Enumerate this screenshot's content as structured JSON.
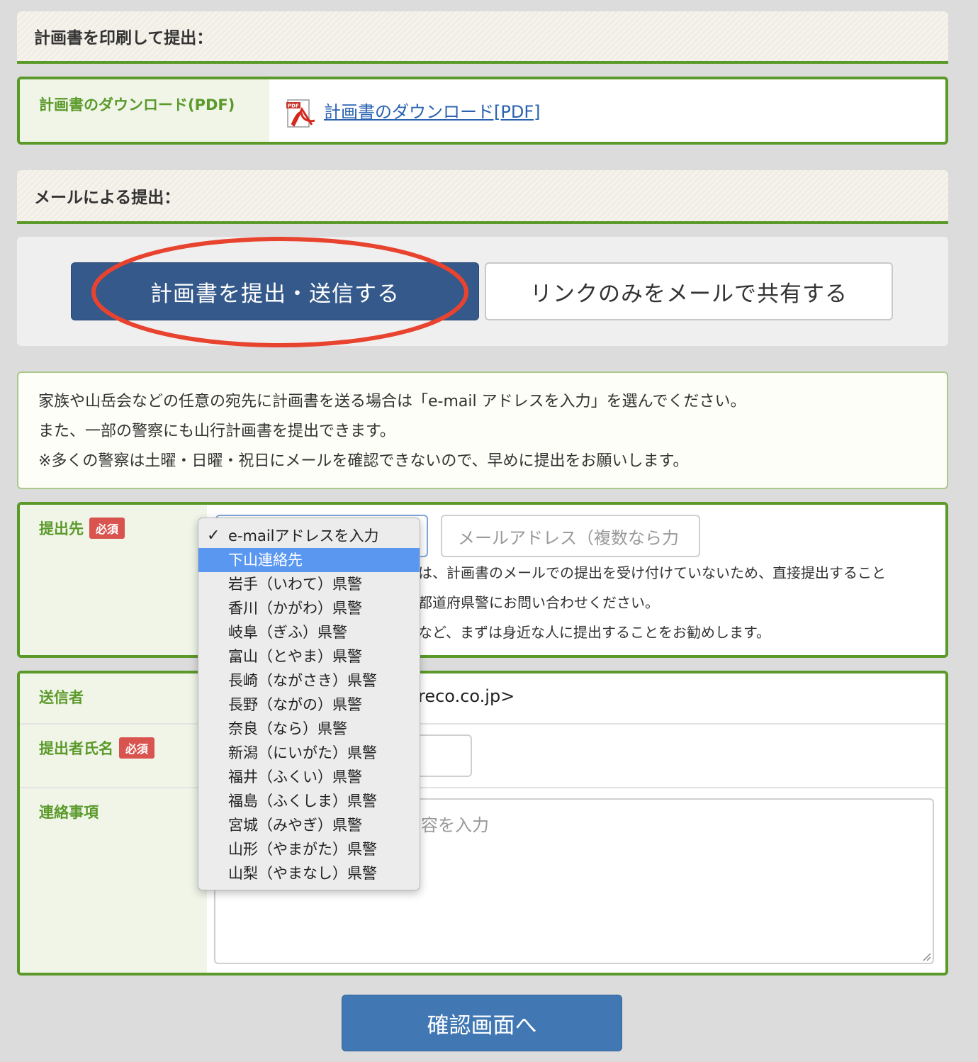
{
  "print_section": {
    "title": "計画書を印刷して提出：",
    "download_label": "計画書のダウンロード(PDF)",
    "download_link": "計画書のダウンロード[PDF]",
    "pdf_icon_text": "PDF"
  },
  "mail_section": {
    "title": "メールによる提出："
  },
  "buttons": {
    "submit": "計画書を提出・送信する",
    "share": "リンクのみをメールで共有する",
    "confirm": "確認画面へ"
  },
  "notice": {
    "line1": "家族や山岳会などの任意の宛先に計画書を送る場合は「e-mail アドレスを入力」を選んでください。",
    "line2": "また、一部の警察にも山行計画書を提出できます。",
    "line3": "※多くの警察は土曜・日曜・祝日にメールを確認できないので、早めに提出をお願いします。"
  },
  "destination": {
    "label": "提出先",
    "required": "必須",
    "email_placeholder": "メールアドレス（複数なら力",
    "help1": "は、計画書のメールでの提出を受け付けていないため、直接提出すること",
    "help2": "都道府県警にお問い合わせください。",
    "help3": "など、まずは身近な人に提出することをお勧めします。"
  },
  "dropdown": {
    "selected": "e-mailアドレスを入力",
    "highlighted": "下山連絡先",
    "options": [
      "岩手（いわて）県警",
      "香川（かがわ）県警",
      "岐阜（ぎふ）県警",
      "富山（とやま）県警",
      "長崎（ながさき）県警",
      "長野（ながの）県警",
      "奈良（なら）県警",
      "新潟（にいがた）県警",
      "福井（ふくい）県警",
      "福島（ふくしま）県警",
      "宮城（みやぎ）県警",
      "山形（やまがた）県警",
      "山梨（やまなし）県警"
    ]
  },
  "sender": {
    "label": "送信者",
    "value": "reco.co.jp>"
  },
  "submitter": {
    "label": "提出者氏名",
    "required": "必須"
  },
  "contact": {
    "label": "連絡事項",
    "placeholder_tail": "容を入力"
  },
  "colors": {
    "green": "#5b9a2a",
    "primary": "#34598a",
    "confirm": "#4178b4",
    "highlight": "#5a97f0",
    "required": "#d9534f",
    "annotation": "#e8432e"
  }
}
